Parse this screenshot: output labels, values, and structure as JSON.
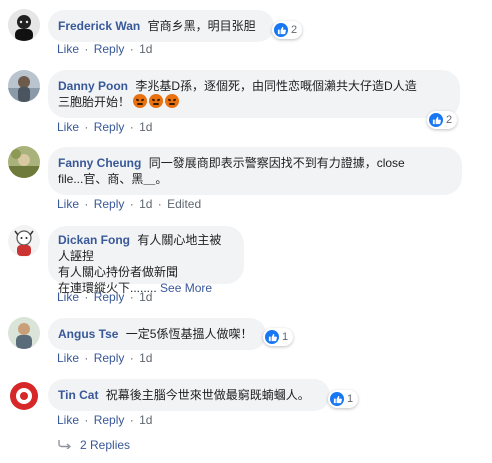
{
  "comments": [
    {
      "author": "Frederick Wan",
      "text": "官商乡黑，明目张胆",
      "reactions": "2",
      "actions": {
        "like": "Like",
        "reply": "Reply",
        "time": "1d"
      }
    },
    {
      "author": "Danny Poon",
      "text_line1": "李兆基D孫，逐個死，由同性恋嘅個瀨共大仔造D人造",
      "text_line2": "三胞胎开始！",
      "emoji": [
        "angry-emoji",
        "angry-emoji",
        "angry-emoji"
      ],
      "reactions": "2",
      "actions": {
        "like": "Like",
        "reply": "Reply",
        "time": "1d"
      }
    },
    {
      "author": "Fanny Cheung",
      "text_line1": "同一發展商即表示警察因找不到有力證據，close",
      "text_line2": "file...官、商、黑＿。",
      "reactions": "",
      "actions": {
        "like": "Like",
        "reply": "Reply",
        "time": "1d",
        "edited": "Edited"
      }
    },
    {
      "author": "Dickan Fong",
      "text_line1": "有人關心地主被人誣揑",
      "text_line2": "有人關心持份者做新聞",
      "text_line3": "在連環縱火下........",
      "see_more": "See More",
      "reactions": "",
      "actions": {
        "like": "Like",
        "reply": "Reply",
        "time": "1d"
      }
    },
    {
      "author": "Angus Tse",
      "text": "一定5係恆基搵人做㗎！",
      "reactions": "1",
      "actions": {
        "like": "Like",
        "reply": "Reply",
        "time": "1d"
      }
    },
    {
      "author": "Tin Cat",
      "text": "祝幕後主腦今世來世做最窮既蝻蟈人。",
      "reactions": "1",
      "actions": {
        "like": "Like",
        "reply": "Reply",
        "time": "1d"
      }
    }
  ],
  "replies": {
    "label": "2 Replies"
  },
  "colors": {
    "link": "#385898",
    "bubble": "#f2f3f5",
    "like_blue": "#1877f2",
    "meta": "#606770"
  }
}
